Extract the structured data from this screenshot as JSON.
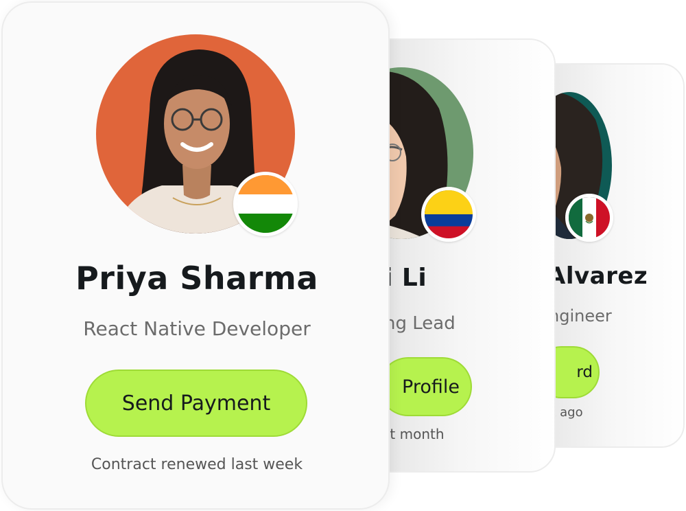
{
  "cards": {
    "back": {
      "name": "Alvarez",
      "role": "ngineer",
      "button_label": "rd",
      "note": "k ago",
      "flag": "mexico-flag",
      "avatar_bg": "#0f5a55"
    },
    "middle": {
      "name": "i Li",
      "role": "ng Lead",
      "button_label": "Profile",
      "note": "st month",
      "flag": "colombia-flag",
      "avatar_bg": "#6e9a6f"
    },
    "front": {
      "name": "Priya Sharma",
      "role": "React Native Developer",
      "button_label": "Send Payment",
      "note": "Contract renewed last week",
      "flag": "india-flag",
      "avatar_bg": "#e0653a"
    }
  },
  "colors": {
    "button": "#b6f24e",
    "button_border": "#9edb36",
    "name_text": "#161a1d",
    "role_text": "#6b6b6b"
  }
}
